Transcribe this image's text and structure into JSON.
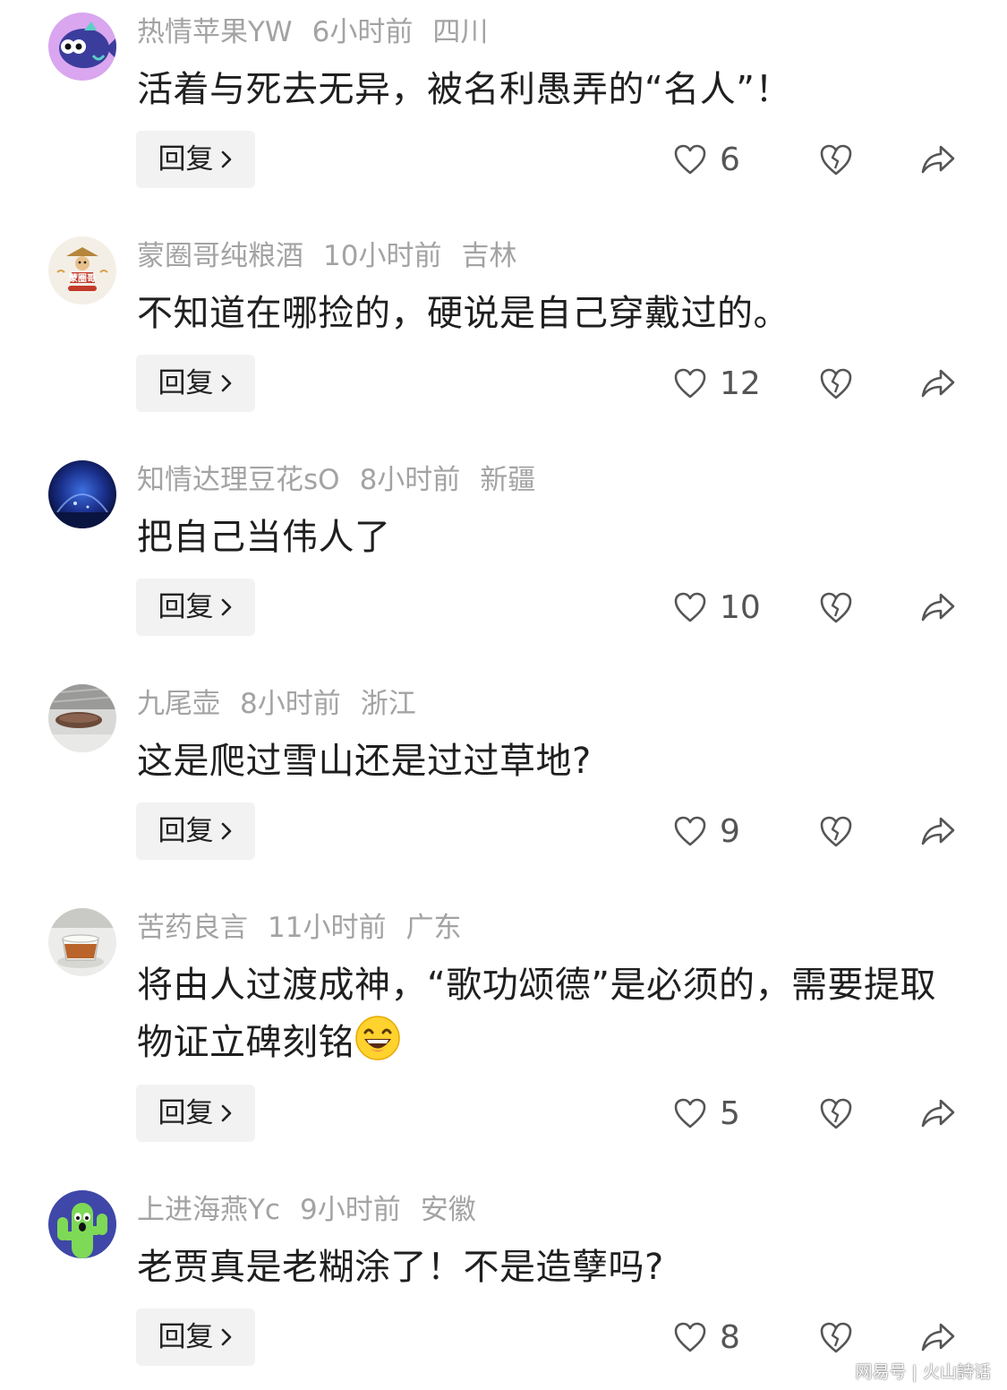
{
  "comments": [
    {
      "username": "热情苹果YW",
      "time": "6小时前",
      "location": "四川",
      "text": "活着与死去无异，被名利愚弄的“名人”！",
      "reply_label": "回复",
      "likes": "6",
      "avatar": "cartoon-fish-avatar"
    },
    {
      "username": "蒙圈哥纯粮酒",
      "time": "10小时前",
      "location": "吉林",
      "text": "不知道在哪捡的，硬说是自己穿戴过的。",
      "reply_label": "回复",
      "likes": "12",
      "avatar": "liquor-brand-logo-avatar",
      "avatar_text": "蒙圈哥"
    },
    {
      "username": "知情达理豆花sO",
      "time": "8小时前",
      "location": "新疆",
      "text": "把自己当伟人了",
      "reply_label": "回复",
      "likes": "10",
      "avatar": "blue-night-scene-avatar"
    },
    {
      "username": "九尾壶",
      "time": "8小时前",
      "location": "浙江",
      "text": "这是爬过雪山还是过过草地?",
      "reply_label": "回复",
      "likes": "9",
      "avatar": "teapot-photo-avatar"
    },
    {
      "username": "苦药良言",
      "time": "11小时前",
      "location": "广东",
      "text": "将由人过渡成神，“歌功颂德”是必须的，需要提取物证立碑刻铭",
      "has_emoji": true,
      "emoji": "laughing-face-emoji",
      "reply_label": "回复",
      "likes": "5",
      "avatar": "tea-cup-photo-avatar"
    },
    {
      "username": "上进海燕Yc",
      "time": "9小时前",
      "location": "安徽",
      "text": "老贾真是老糊涂了！不是造孽吗?",
      "reply_label": "回复",
      "likes": "8",
      "avatar": "cactus-cartoon-avatar"
    }
  ],
  "icons": {
    "like": "heart-outline-icon",
    "dislike": "broken-heart-icon",
    "share": "share-arrow-icon",
    "reply_chevron": "chevron-right-icon"
  },
  "watermark": "网易号 | 火山詩话",
  "colors": {
    "meta_text": "#a3a3a3",
    "body_text": "#1f1f1f",
    "reply_bg": "#f2f2f2",
    "icon": "#555555"
  }
}
